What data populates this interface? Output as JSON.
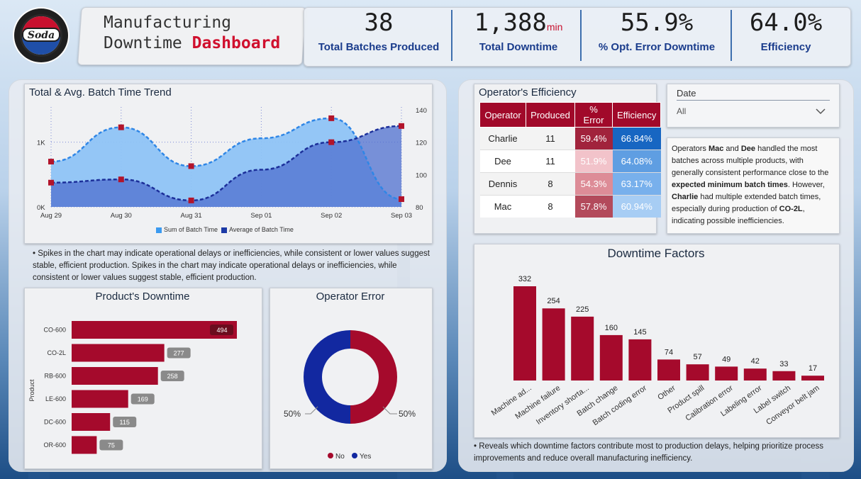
{
  "header": {
    "title_line1": "Manufacturing",
    "title_line2a": "Downtime",
    "title_line2b": "Dashboard",
    "logo_text": "Soda"
  },
  "kpis": [
    {
      "value": "38",
      "unit": "",
      "label": "Total Batches Produced"
    },
    {
      "value": "1,388",
      "unit": "min",
      "label": "Total Downtime"
    },
    {
      "value": "55.9%",
      "unit": "",
      "label": "% Opt. Error Downtime"
    },
    {
      "value": "64.0%",
      "unit": "",
      "label": "Efficiency"
    }
  ],
  "trend": {
    "title": "Total & Avg. Batch Time Trend",
    "legend_sum": "Sum of Batch Time",
    "legend_avg": "Average of Batch Time",
    "note": "• Spikes in the chart may indicate operational delays or inefficiencies, while consistent or lower values suggest stable, efficient production. Spikes in the chart may indicate operational delays or inefficiencies, while consistent or lower values suggest stable, efficient production.",
    "note_bold": "Spikes in the chart may indicate operational delays or inefficiencies, while consistent or lower values suggest stable, efficient production."
  },
  "operators": {
    "title": "Operator's Efficiency",
    "headers": [
      "Operator",
      "Produced",
      "% Error",
      "Efficiency"
    ],
    "rows": [
      {
        "name": "Charlie",
        "produced": "11",
        "error": "59.4%",
        "eff": "66.84%"
      },
      {
        "name": "Dee",
        "produced": "11",
        "error": "51.9%",
        "eff": "64.08%"
      },
      {
        "name": "Dennis",
        "produced": "8",
        "error": "54.3%",
        "eff": "63.17%"
      },
      {
        "name": "Mac",
        "produced": "8",
        "error": "57.8%",
        "eff": "60.94%"
      }
    ]
  },
  "date_filter": {
    "label": "Date",
    "value": "All"
  },
  "insight": {
    "p1": "Operators ",
    "b1": "Mac",
    "p2": " and ",
    "b2": "Dee",
    "p3": " handled the most batches across multiple products, with generally consistent performance close to the ",
    "b3": "expected minimum batch times",
    "p4": ". However, ",
    "b4": "Charlie",
    "p5": " had multiple extended batch times, especially during production of ",
    "b5": "CO-2L",
    "p6": ", indicating possible inefficiencies."
  },
  "product_title": "Product's Downtime",
  "product_axis": "Product",
  "operr_title": "Operator Error",
  "operr_legend": [
    "No",
    "Yes"
  ],
  "operr_labels": [
    "50%",
    "50%"
  ],
  "factors_title": "Downtime Factors",
  "factors_note": "• Reveals which downtime factors contribute most to production delays, helping prioritize process improvements and reduce overall manufacturing inefficiency.",
  "colors": {
    "accent_red": "#a1092a",
    "kpi_blue": "#1a3c8c",
    "area_light": "#8ec3f5",
    "area_dark": "#5b7fd6"
  },
  "chart_data": [
    {
      "type": "area",
      "title": "Total & Avg. Batch Time Trend",
      "x": [
        "Aug 29",
        "Aug 30",
        "Aug 31",
        "Sep 01",
        "Sep 02",
        "Sep 03"
      ],
      "y_left_ticks": [
        "0K",
        "1K"
      ],
      "y_right_ticks": [
        "80",
        "100",
        "120",
        "140"
      ],
      "ylim_left": [
        0,
        1500
      ],
      "ylim_right": [
        80,
        140
      ],
      "series": [
        {
          "name": "Sum of Batch Time",
          "axis": "left",
          "values": [
            700,
            1230,
            630,
            null,
            1370,
            120
          ]
        },
        {
          "name": "Average of Batch Time",
          "axis": "right",
          "values": [
            95,
            97,
            84,
            null,
            120,
            130
          ]
        }
      ],
      "sep01_sum_interp": 1060,
      "sep01_avg_interp": 103
    },
    {
      "type": "bar",
      "title": "Product's Downtime",
      "categories": [
        "CO-600",
        "CO-2L",
        "RB-600",
        "LE-600",
        "DC-600",
        "OR-600"
      ],
      "values": [
        494,
        277,
        258,
        169,
        115,
        75
      ]
    },
    {
      "type": "pie",
      "title": "Operator Error",
      "categories": [
        "No",
        "Yes"
      ],
      "values": [
        50,
        50
      ]
    },
    {
      "type": "bar",
      "title": "Downtime Factors",
      "categories": [
        "Machine ad...",
        "Machine failure",
        "Inventory shorta...",
        "Batch change",
        "Batch coding error",
        "Other",
        "Product spill",
        "Calibration error",
        "Labeling error",
        "Label switch",
        "Conveyor belt jam"
      ],
      "values": [
        332,
        254,
        225,
        160,
        145,
        74,
        57,
        49,
        42,
        33,
        17
      ]
    }
  ]
}
